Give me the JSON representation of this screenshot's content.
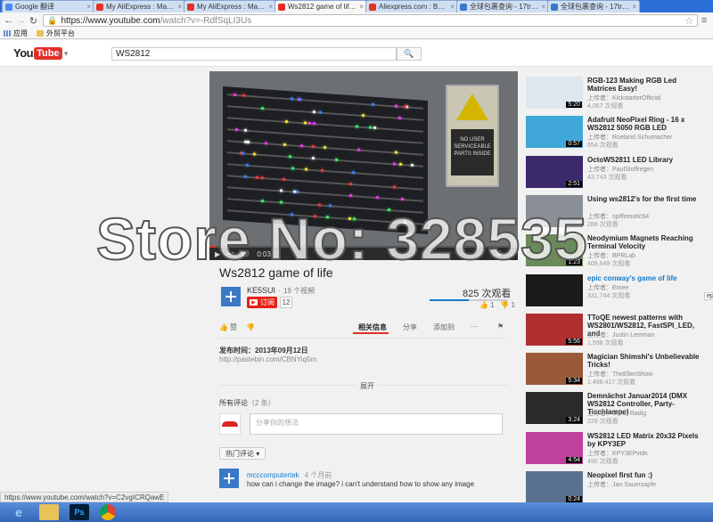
{
  "browser": {
    "tabs": [
      {
        "label": "Google 翻译",
        "fav": "#4a8af4",
        "active": false
      },
      {
        "label": "My AliExpress : Manage",
        "fav": "#e43225",
        "active": false
      },
      {
        "label": "My AliExpress : Manage",
        "fav": "#e43225",
        "active": false
      },
      {
        "label": "Ws2812 game of life - Y",
        "fav": "#e52d27",
        "active": true
      },
      {
        "label": "Aliexpress.com : Buy Et",
        "fav": "#e43225",
        "active": false
      },
      {
        "label": "全球包裹查询 - 17track",
        "fav": "#3a78c8",
        "active": false
      },
      {
        "label": "全球包裹查询 - 17track",
        "fav": "#3a78c8",
        "active": false
      }
    ],
    "url_host": "https://www.youtube.com",
    "url_path": "/watch?v=-RdfSqLI3Us",
    "bookmarks": {
      "apps": "应用",
      "folder": "外贸平台"
    }
  },
  "youtube": {
    "logo_you": "You",
    "logo_tube": "Tube",
    "search_value": "WS2812"
  },
  "player": {
    "time": "0:03 / 1",
    "progress": 0.02,
    "warning_text": "NO USER SERVICEABLE PARTS INSIDE"
  },
  "video": {
    "title": "Ws2812 game of life",
    "channel": "KE5SUI",
    "channel_videos": "19 个视频",
    "subscribe_label": "订阅",
    "subscriber_count": "12",
    "views": "825 次观看",
    "likes": "1",
    "dislikes": "1",
    "like_icon_label": "赞",
    "tabs": [
      "相关信息",
      "分享",
      "添加到"
    ],
    "published": "发布时间：2013年09月12日",
    "link": "http://pastebin.com/CBNYiq5m",
    "expand": "展开",
    "comments_title": "所有评论",
    "comments_count": "（2 条）",
    "comment_placeholder": "分享你的想法",
    "sort_label": "热门评论",
    "comment": {
      "author": "mcccomputertek",
      "time": "4 个月前",
      "text": "how can i change the image? i can't understand how to show any image"
    }
  },
  "related": [
    {
      "title": "RGB-123 Making RGB Led Matrices Easy!",
      "by": "上传者：KickstarterOfficial",
      "views": "4,067 次观看",
      "dur": "5:20",
      "thumb": "#dfe7ee",
      "link": false
    },
    {
      "title": "Adafruit NeoPixel Ring - 16 x WS2812 5050 RGB LED",
      "by": "上传者：Roeland Schumacher",
      "views": "654 次观看",
      "dur": "0:57",
      "thumb": "#40a8d8",
      "link": false
    },
    {
      "title": "OctoWS2811 LED Library",
      "by": "上传者：PaulStoffregen",
      "views": "43,743 次观看",
      "dur": "2:51",
      "thumb": "#3a2a6a",
      "link": false
    },
    {
      "title": "Using ws2812's for the first time",
      "by": "上传者：spiffomatic64",
      "views": "288 次观看",
      "dur": "",
      "thumb": "#8a8f96",
      "link": false
    },
    {
      "title": "Neodymium Magnets Reaching Terminal Velocity",
      "by": "上传者：BPRLab",
      "views": "409,649 次观看",
      "dur": "1:23",
      "thumb": "#6b8a5a",
      "link": false
    },
    {
      "title": "epic conway's game of life",
      "by": "上传者：Emee",
      "views": "331,744 次观看",
      "dur": "",
      "thumb": "#1a1a1a",
      "link": true
    },
    {
      "title": "TToQE newest patterns with WS2801/WS2812, FastSPI_LED, and",
      "by": "上传者：Justin Lemman",
      "views": "1,598 次观看",
      "dur": "5:56",
      "thumb": "#b03030",
      "link": false
    },
    {
      "title": "Magician Shimshi's Unbelievable Tricks!",
      "by": "上传者：TheEllenShow",
      "views": "1,498,417 次观看",
      "dur": "5:34",
      "thumb": "#9a5a3a",
      "link": false
    },
    {
      "title": "Demnächst Januar2014 (DMX WS2812 Controller, Party- Tischlampe)",
      "by": "上传者：Ulrich Radig",
      "views": "229 次观看",
      "dur": "3:24",
      "thumb": "#2a2a2a",
      "link": false
    },
    {
      "title": "WS2812 LED Matrix 20x32 Pixels by KPY3EP",
      "by": "上传者：KPY3EPvids",
      "views": "490 次观看",
      "dur": "4:54",
      "thumb": "#c040a0",
      "link": false
    },
    {
      "title": "Neopixel first fun :)",
      "by": "上传者：Jan Sauerzapfe",
      "views": "",
      "dur": "0:24",
      "thumb": "#5a7090",
      "link": false
    }
  ],
  "watermark": "Store No: 328535",
  "side_tag": "ep",
  "status_url": "https://www.youtube.com/watch?v=C2vgICRQawE"
}
